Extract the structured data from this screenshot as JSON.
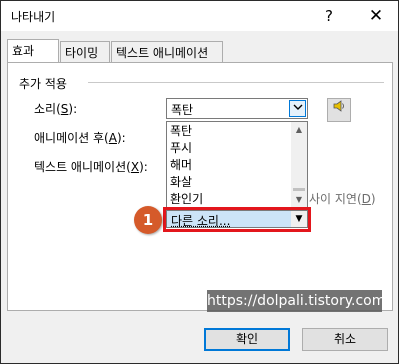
{
  "window": {
    "title": "나타내기",
    "help_label": "?",
    "close_label": "✕"
  },
  "tabs": [
    {
      "label": "효과",
      "active": true
    },
    {
      "label": "타이밍",
      "active": false
    },
    {
      "label": "텍스트 애니메이션",
      "active": false
    }
  ],
  "group": {
    "label": "추가 적용"
  },
  "sound": {
    "label_prefix": "소리(",
    "label_key": "S",
    "label_suffix": "):",
    "value": "폭탄",
    "button_icon": "speaker-icon"
  },
  "after_animation": {
    "label_prefix": "애니메이션 후(",
    "label_key": "A",
    "label_suffix": "):"
  },
  "text_animation": {
    "label_prefix": "텍스트 애니메이션(",
    "label_key": "X",
    "label_suffix": "):"
  },
  "sound_list": {
    "items": [
      "폭탄",
      "푸시",
      "해머",
      "화살",
      "환인기"
    ],
    "selected": "다른 소리..."
  },
  "delay": {
    "text_visible": "사이 지연(",
    "key": "D",
    "text_suffix": ")"
  },
  "callout": {
    "number": "1"
  },
  "watermark": {
    "text": "https://dolpali.tistory.com"
  },
  "buttons": {
    "ok": "확인",
    "cancel": "취소"
  },
  "colors": {
    "highlight_red": "#e3161c",
    "callout_orange": "#d55a2a",
    "selection_blue": "#cce4f7",
    "accent_blue": "#0078d7"
  }
}
